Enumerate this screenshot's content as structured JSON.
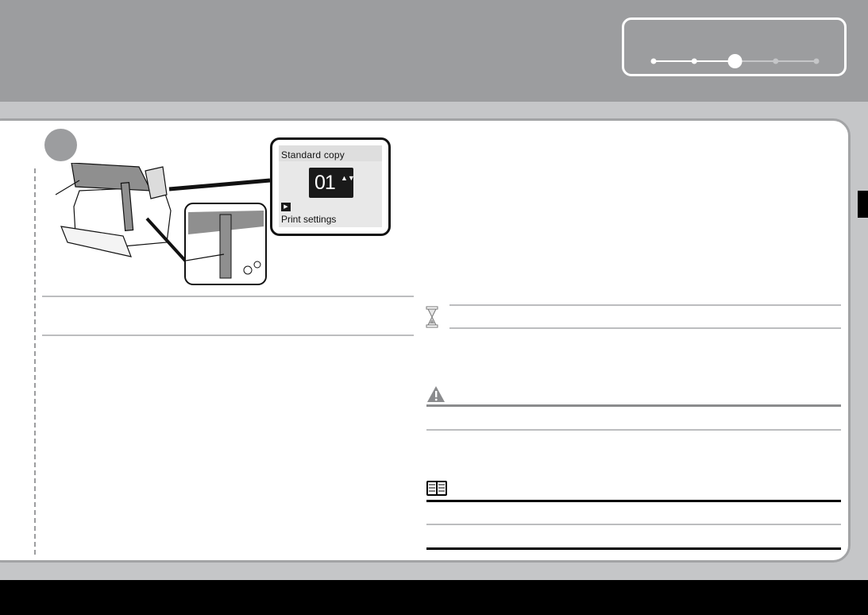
{
  "header": {
    "progress": {
      "total_steps": 5,
      "current_step": 3,
      "active_color": "#ffffff",
      "inactive_color": "#c5c6c8"
    }
  },
  "step": {
    "marker_color": "#9c9d9f"
  },
  "lcd": {
    "title": "Standard copy",
    "count": "01",
    "arrows": "▲▼",
    "play_glyph": "▶",
    "subtitle": "Print settings"
  },
  "icons": {
    "hourglass": "hourglass-icon",
    "warning": "warning-icon",
    "note": "book-icon"
  },
  "colors": {
    "header_bg": "#9c9d9f",
    "band_bg": "#c5c6c8",
    "panel_border": "#a2a3a5",
    "footer_bg": "#000000"
  }
}
